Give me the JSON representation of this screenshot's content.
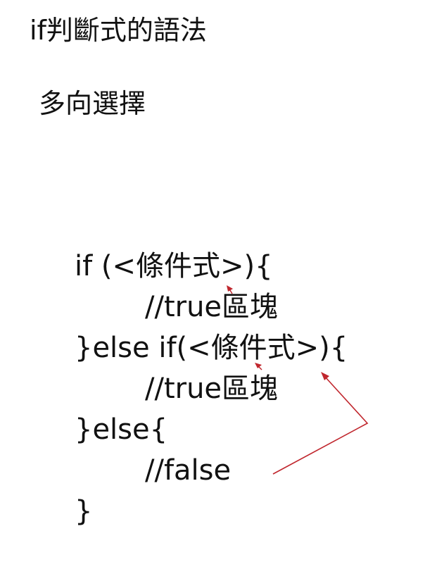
{
  "slide": {
    "title": "if判斷式的語法",
    "subtitle": "多向選擇",
    "code_lines": [
      "if (<條件式>){",
      "//true區塊",
      "}else if(<條件式>){",
      "//true區塊",
      "}else{",
      "//false",
      "}"
    ]
  },
  "colors": {
    "text": "#111111",
    "arrow": "#c0262d",
    "background": "#ffffff"
  }
}
